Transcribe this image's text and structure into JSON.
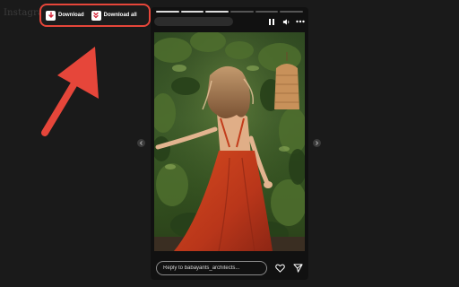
{
  "background": {
    "logo_text": "Instagram"
  },
  "extension": {
    "download_label": "Download",
    "download_all_label": "Download all",
    "accent_color": "#e6463a",
    "icon_color": "#d6263a"
  },
  "story": {
    "progress_segments": 6,
    "progress_completed": 3,
    "reply_placeholder": "Reply to babayants_architects..."
  }
}
